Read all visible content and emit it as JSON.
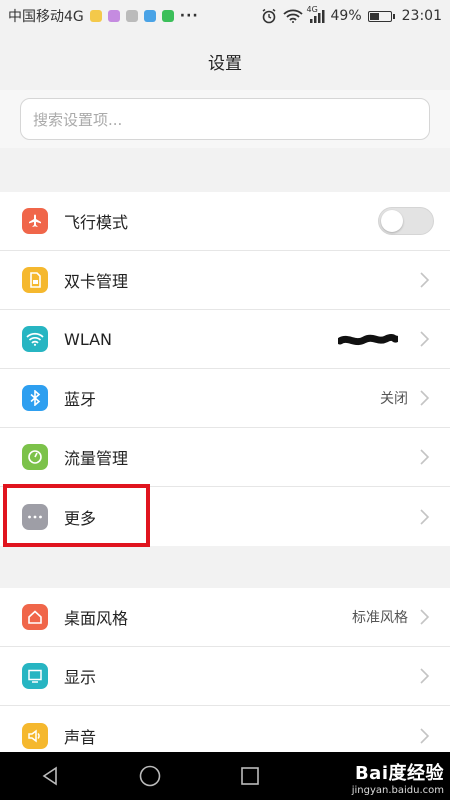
{
  "status_bar": {
    "carrier": "中国移动4G",
    "more": "···",
    "network": "4G",
    "battery_percent": "49%",
    "battery_level": 0.49,
    "time": "23:01"
  },
  "header": {
    "title": "设置"
  },
  "search": {
    "placeholder": "搜索设置项..."
  },
  "group1": [
    {
      "label": "飞行模式",
      "icon": "airplane-icon",
      "color": "#f0664a",
      "toggle": false
    },
    {
      "label": "双卡管理",
      "icon": "sim-card-icon",
      "color": "#f5b82e"
    },
    {
      "label": "WLAN",
      "icon": "wifi-icon",
      "color": "#27b5c2"
    },
    {
      "label": "蓝牙",
      "icon": "bluetooth-icon",
      "color": "#2e9ff0",
      "value": "关闭"
    },
    {
      "label": "流量管理",
      "icon": "data-usage-icon",
      "color": "#7cc24a"
    },
    {
      "label": "更多",
      "icon": "more-icon",
      "color": "#9e9ea6"
    }
  ],
  "group2": [
    {
      "label": "桌面风格",
      "icon": "home-icon",
      "color": "#f0664a",
      "value": "标准风格"
    },
    {
      "label": "显示",
      "icon": "display-icon",
      "color": "#27b5c2"
    },
    {
      "label": "声音",
      "icon": "speaker-icon",
      "color": "#f5b82e"
    }
  ],
  "watermark": {
    "main": "Bai度经验",
    "sub": "jingyan.baidu.com"
  },
  "colors": {
    "highlight": "#e0141e",
    "background": "#f2f2f2"
  }
}
